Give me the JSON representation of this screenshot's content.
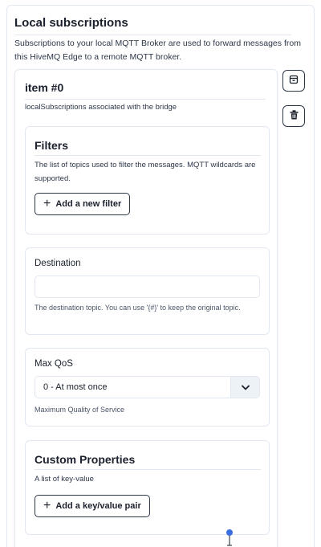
{
  "section": {
    "title": "Local subscriptions",
    "description": "Subscriptions to your local MQTT Broker are used to forward messages from this HiveMQ Edge to a remote MQTT broker."
  },
  "item": {
    "title": "item #0",
    "description": "localSubscriptions associated with the bridge",
    "actions": {
      "collapse_icon": "collapse-icon",
      "delete_icon": "trash-icon"
    }
  },
  "filters": {
    "heading": "Filters",
    "description": "The list of topics used to filter the messages. MQTT wildcards are supported.",
    "add_button": "Add a new filter"
  },
  "destination": {
    "label": "Destination",
    "value": "",
    "helper": "The destination topic. You can use '{#}' to keep the original topic."
  },
  "max_qos": {
    "label": "Max QoS",
    "selected": "0 - At most once",
    "helper": "Maximum Quality of Service"
  },
  "custom_properties": {
    "heading": "Custom Properties",
    "description": "A list of key-value",
    "add_button": "Add a key/value pair"
  },
  "colors": {
    "text": "#1a202c",
    "border": "#e2e8f0",
    "accent": "#3b6fe0"
  }
}
